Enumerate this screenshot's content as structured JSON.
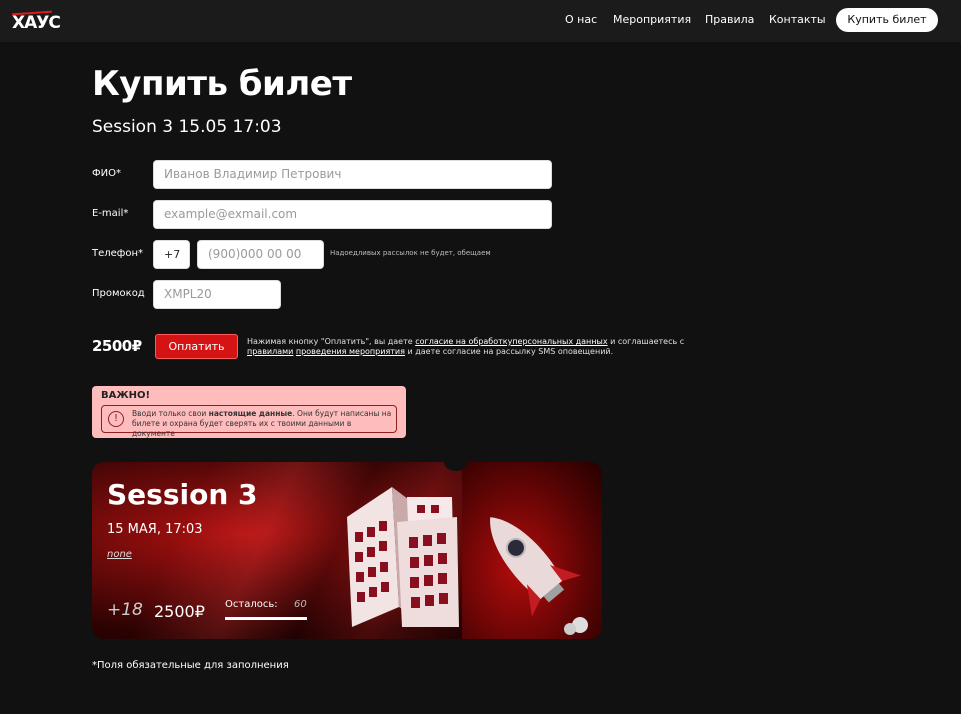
{
  "nav": {
    "logo": "ХАУС",
    "links": [
      "О нас",
      "Мероприятия",
      "Правила",
      "Контакты"
    ],
    "buy_label": "Купить билет"
  },
  "page": {
    "title": "Купить билет",
    "subtitle": "Session 3 15.05 17:03"
  },
  "form": {
    "name_label": "ФИО*",
    "name_placeholder": "Иванов Владимир Петрович",
    "email_label": "E-mail*",
    "email_placeholder": "example@exmail.com",
    "phone_label": "Телефон*",
    "phone_code": "+7",
    "phone_placeholder": "(900)000 00 00",
    "phone_note": "Надоедливых рассылок не будет, обещаем",
    "promo_label": "Промокод",
    "promo_placeholder": "XMPL20"
  },
  "payment": {
    "price": "2500₽",
    "pay_label": "Оплатить",
    "consent_1": "Нажимая кнопку \"Оплатить\", вы даете ",
    "consent_link_1": "согласие на обработкуперсональных данных",
    "consent_2": " и соглашаетесь с ",
    "consent_link_2": "правилами",
    "consent_3": " ",
    "consent_link_3": "проведения мероприятия",
    "consent_4": " и даете согласие на рассылку SMS оповещений."
  },
  "warning": {
    "title": "ВАЖНО!",
    "icon": "!",
    "text_1": "Вводи только свои ",
    "text_bold": "настоящие данные",
    "text_2": ". Они будут написаны на билете и охрана будет сверять их с твоими данными в документе"
  },
  "event_card": {
    "title": "Session 3",
    "date": "15 МАЯ, 17:03",
    "location": "none",
    "age": "+18",
    "price": "2500₽",
    "remaining_label": "Осталось:",
    "remaining_value": "60"
  },
  "footer": {
    "note": "*Поля обязательные для заполнения"
  },
  "colors": {
    "accent": "#d41414",
    "background": "#111111",
    "warning_bg": "#ffbcbc"
  }
}
